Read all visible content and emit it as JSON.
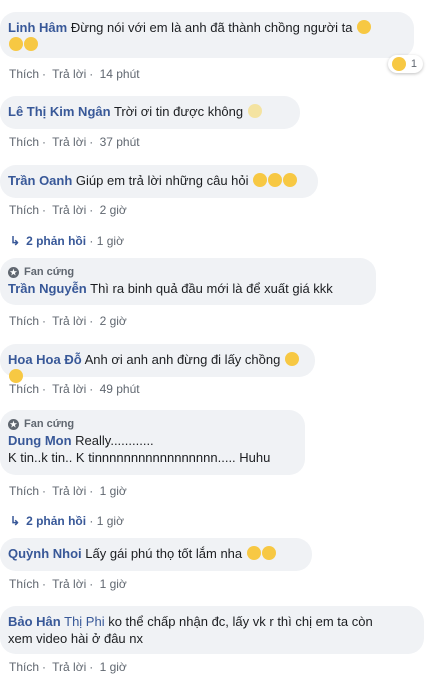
{
  "common": {
    "like": "Thích",
    "reply": "Trả lời",
    "fan_badge": "Fan cứng"
  },
  "comments": [
    {
      "name": "Linh Hâm",
      "line1": "Đừng nói với em là anh đã thành chồng người ta",
      "time": "14 phút",
      "reaction_count": "1"
    },
    {
      "name": "Lê Thị Kim Ngân",
      "text": "Trời ơi tin được không",
      "time": "37 phút"
    },
    {
      "name": "Trần Oanh",
      "text": "Giúp em trả lời những câu hỏi",
      "time": "2 giờ",
      "replies": "2 phản hồi",
      "replies_time": "1 giờ"
    },
    {
      "name": "Trần Nguyễn",
      "text": "Thì ra binh quả đầu mới là để xuất giá kkk",
      "time": "2 giờ"
    },
    {
      "name": "Hoa Hoa Đỗ",
      "text": "Anh ơi anh anh đừng đi lấy chồng",
      "time": "49 phút"
    },
    {
      "name": "Dung Mon",
      "line1": "Really............",
      "line2": "K tin..k tin.. K tinnnnnnnnnnnnnnnnn..... Huhu",
      "time": "1 giờ",
      "replies": "2 phản hồi",
      "replies_time": "1 giờ"
    },
    {
      "name": "Quỳnh Nhoi",
      "text": "Lấy gái phú thọ tốt lắm nha",
      "time": "1 giờ"
    },
    {
      "name": "Bảo Hân",
      "name2": "Thị Phi",
      "line1": "ko thể chấp nhận đc, lấy vk r thì chị em ta còn",
      "line2": "xem video hài ở đâu nx",
      "time": "1 giờ"
    }
  ]
}
